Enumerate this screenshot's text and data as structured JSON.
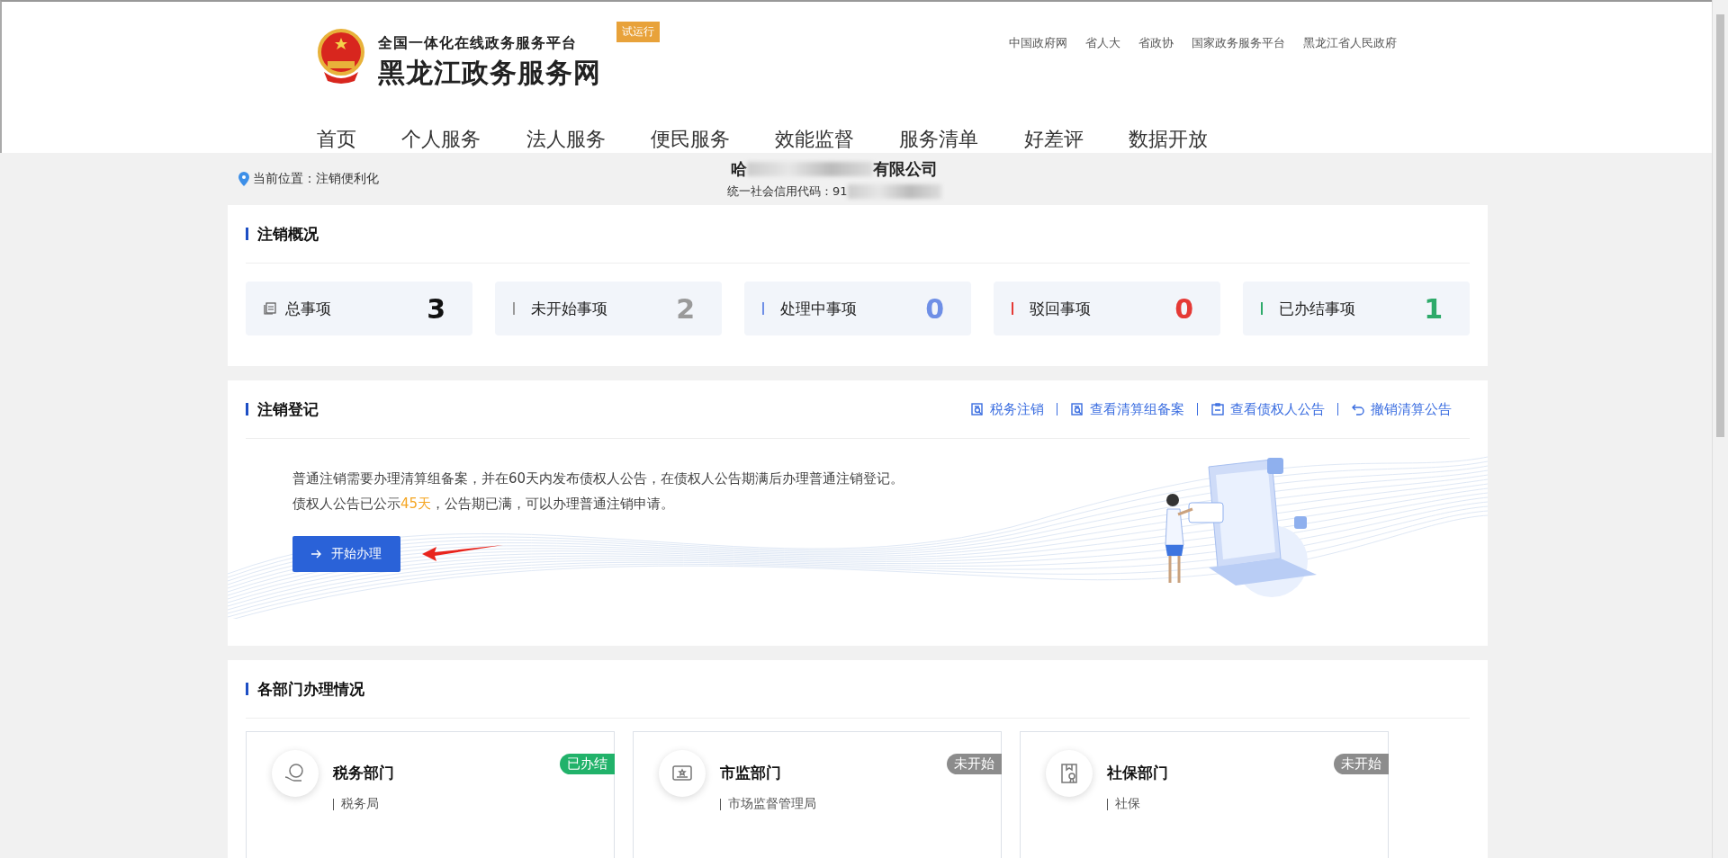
{
  "header": {
    "platform_title": "全国一体化在线政务服务平台",
    "site_title": "黑龙江政务服务网",
    "badge": "试运行",
    "links": [
      "中国政府网",
      "省人大",
      "省政协",
      "国家政务服务平台",
      "黑龙江省人民政府"
    ],
    "nav": [
      {
        "label": "首页",
        "selected": false
      },
      {
        "label": "个人服务",
        "selected": false
      },
      {
        "label": "法人服务",
        "selected": false
      },
      {
        "label": "便民服务",
        "selected": false
      },
      {
        "label": "效能监督",
        "selected": false
      },
      {
        "label": "服务清单",
        "selected": false
      },
      {
        "label": "好差评",
        "selected": false
      },
      {
        "label": "数据开放",
        "selected": false
      }
    ]
  },
  "breadcrumb": {
    "label": "当前位置：",
    "current": "注销便利化"
  },
  "company": {
    "name_start": "哈",
    "name_end": "有限公司",
    "credit_code_label": "统一社会信用代码：91"
  },
  "overview": {
    "title": "注销概况",
    "stats": [
      {
        "kind": "total",
        "label": "总事项",
        "value": "3",
        "color": "#111111"
      },
      {
        "kind": "bar",
        "label": "未开始事项",
        "value": "2",
        "color": "#9a9a9a"
      },
      {
        "kind": "bar",
        "label": "处理中事项",
        "value": "0",
        "color": "#6f8fe6"
      },
      {
        "kind": "bar",
        "label": "驳回事项",
        "value": "0",
        "color": "#e53935"
      },
      {
        "kind": "bar",
        "label": "已办结事项",
        "value": "1",
        "color": "#2eaa6a"
      }
    ]
  },
  "registration": {
    "title": "注销登记",
    "actions": [
      "税务注销",
      "查看清算组备案",
      "查看债权人公告",
      "撤销清算公告"
    ],
    "line_1": "普通注销需要办理清算组备案，并在60天内发布债权人公告，在债权人公告期满后办理普通注销登记。",
    "line_2_start": "债权人公告已公示",
    "line_2_days": "45天",
    "line_2_end": "，公告期已满，可以办理普通注销申请。",
    "button": "开始办理"
  },
  "departments": {
    "title": "各部门办理情况",
    "items": [
      {
        "kind": "tax",
        "name": "税务部门",
        "agency": "税务局",
        "status": "已办结",
        "color": "#21b26a"
      },
      {
        "kind": "market",
        "name": "市监部门",
        "agency": "市场监督管理局",
        "status": "未开始",
        "color": "#8c8c8c"
      },
      {
        "kind": "social",
        "name": "社保部门",
        "agency": "社保",
        "status": "未开始",
        "color": "#8c8c8c"
      }
    ]
  }
}
